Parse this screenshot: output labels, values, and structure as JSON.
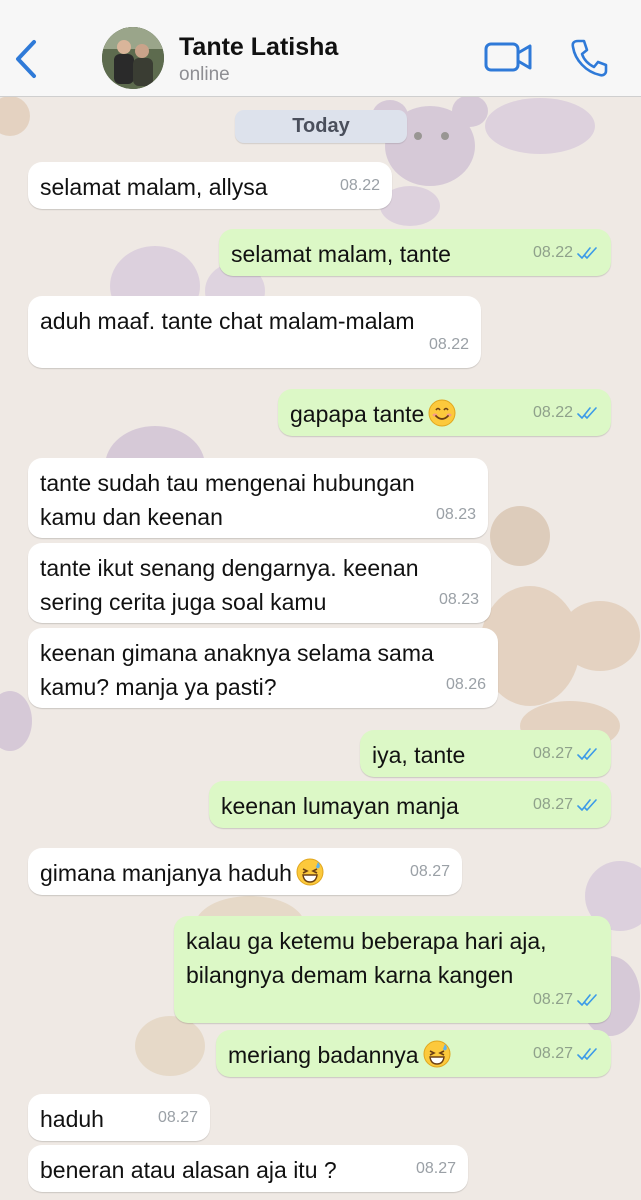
{
  "header": {
    "contact_name": "Tante Latisha",
    "status": "online"
  },
  "date_label": "Today",
  "colors": {
    "accent": "#2f7ad8",
    "incoming_bubble": "#ffffff",
    "outgoing_bubble": "#dcf8c6",
    "read_ticks": "#3b9ae8"
  },
  "messages": [
    {
      "dir": "in",
      "text": "selamat malam, allysa",
      "time": "08.22"
    },
    {
      "dir": "out",
      "text": "selamat malam, tante",
      "time": "08.22",
      "read": true
    },
    {
      "dir": "in",
      "text": "aduh maaf. tante chat malam-malam",
      "time": "08.22"
    },
    {
      "dir": "out",
      "text": "gapapa tante",
      "emoji": "smiling-face",
      "time": "08.22",
      "read": true
    },
    {
      "dir": "in",
      "text": "tante sudah tau mengenai hubungan\nkamu dan keenan",
      "time": "08.23"
    },
    {
      "dir": "in",
      "text": "tante ikut senang dengarnya. keenan\nsering cerita juga soal kamu",
      "time": "08.23"
    },
    {
      "dir": "in",
      "text": "keenan gimana anaknya selama sama\nkamu? manja ya pasti?",
      "time": "08.26"
    },
    {
      "dir": "out",
      "text": "iya, tante",
      "time": "08.27",
      "read": true
    },
    {
      "dir": "out",
      "text": "keenan lumayan manja",
      "time": "08.27",
      "read": true
    },
    {
      "dir": "in",
      "text": "gimana manjanya haduh",
      "emoji": "grinning-sweat",
      "time": "08.27"
    },
    {
      "dir": "out",
      "text": "kalau ga ketemu beberapa hari aja,\nbilangnya demam karna kangen",
      "time": "08.27",
      "read": true
    },
    {
      "dir": "out",
      "text": "meriang badannya",
      "emoji": "grinning-sweat",
      "time": "08.27",
      "read": true
    },
    {
      "dir": "in",
      "text": "haduh",
      "time": "08.27"
    },
    {
      "dir": "in",
      "text": "beneran atau alasan aja itu ?",
      "time": "08.27"
    }
  ]
}
